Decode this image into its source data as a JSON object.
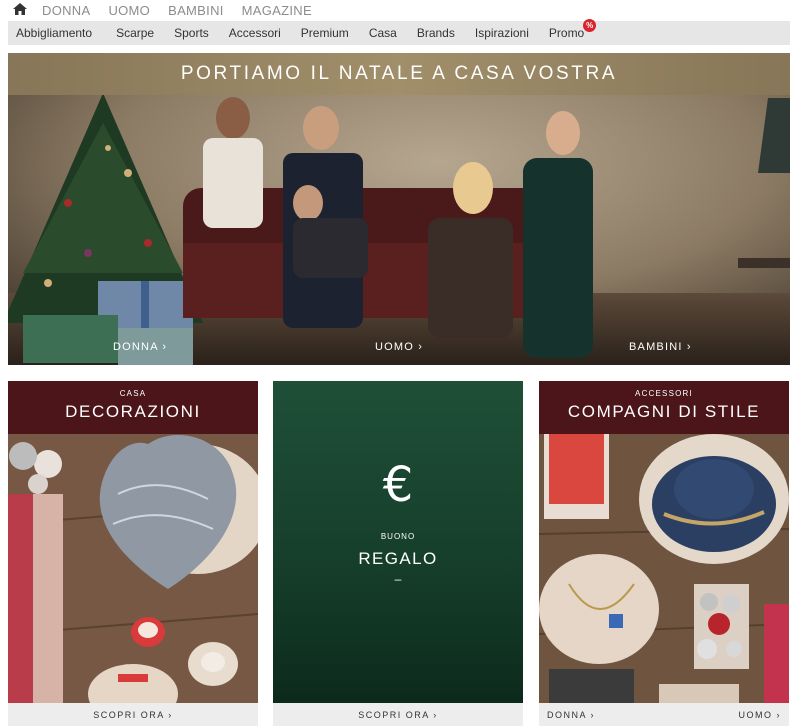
{
  "topnav": {
    "home_icon": "home-icon",
    "items": [
      "DONNA",
      "UOMO",
      "BAMBINI",
      "MAGAZINE"
    ]
  },
  "subnav": {
    "items": [
      "Abbigliamento",
      "Scarpe",
      "Sports",
      "Accessori",
      "Premium",
      "Casa",
      "Brands",
      "Ispirazioni",
      "Promo"
    ],
    "promo_badge": "%"
  },
  "hero": {
    "title": "PORTIAMO IL NATALE A CASA VOSTRA",
    "links": [
      "DONNA ›",
      "UOMO ›",
      "BAMBINI ›"
    ]
  },
  "cards": {
    "left": {
      "kicker": "CASA",
      "title": "DECORAZIONI",
      "footer": "SCOPRI ORA ›"
    },
    "middle": {
      "symbol": "€",
      "kicker": "BUONO",
      "title": "REGALO",
      "dash": "–",
      "footer": "SCOPRI ORA ›"
    },
    "right": {
      "kicker": "ACCESSORI",
      "title": "COMPAGNI DI STILE",
      "footer_left": "DONNA ›",
      "footer_right": "UOMO ›"
    }
  },
  "colors": {
    "header_maroon": "#4b1519",
    "gift_green": "#1f4f37",
    "promo_red": "#d9232d",
    "hero_banner_gold": "#9a8866"
  }
}
